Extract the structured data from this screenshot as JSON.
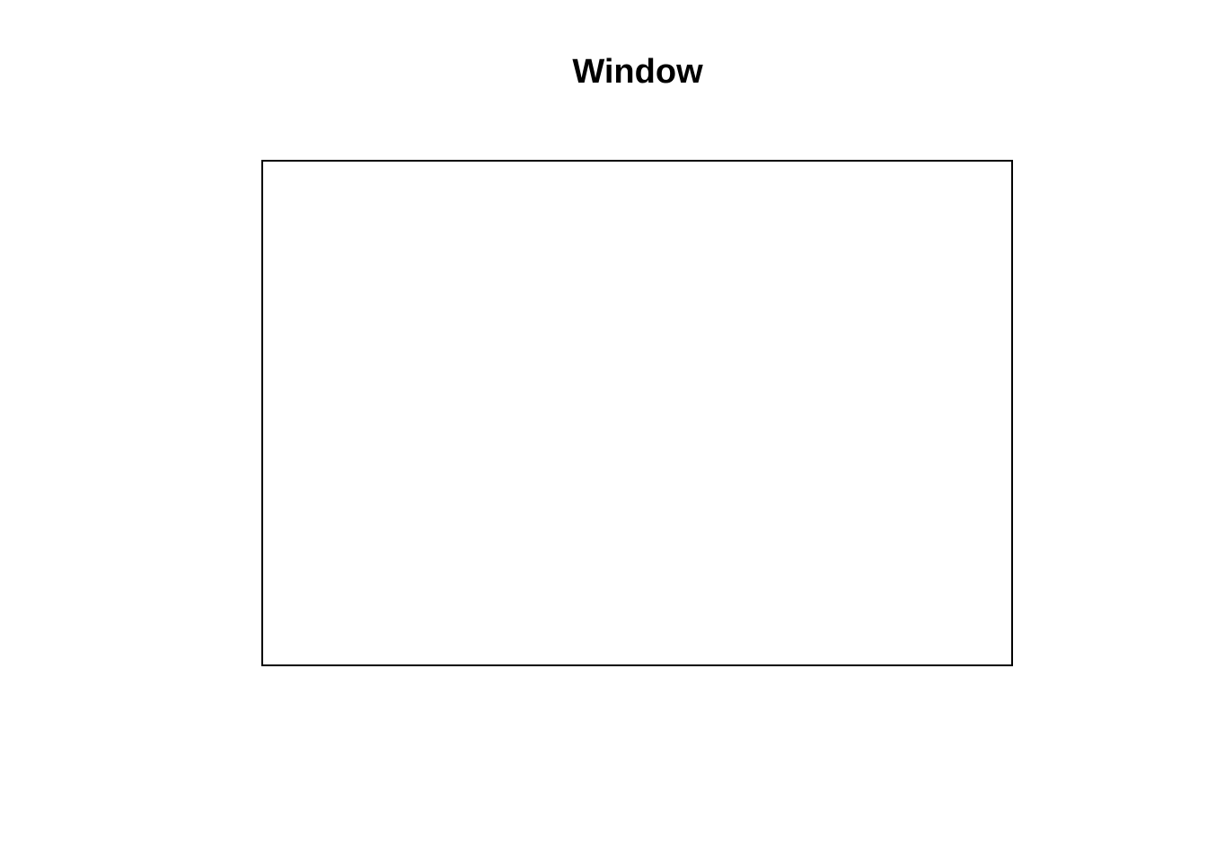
{
  "window": {
    "title": "Window"
  },
  "colors": {
    "background": "#ffffff",
    "frame_border": "#000000",
    "title_text": "#000000"
  }
}
